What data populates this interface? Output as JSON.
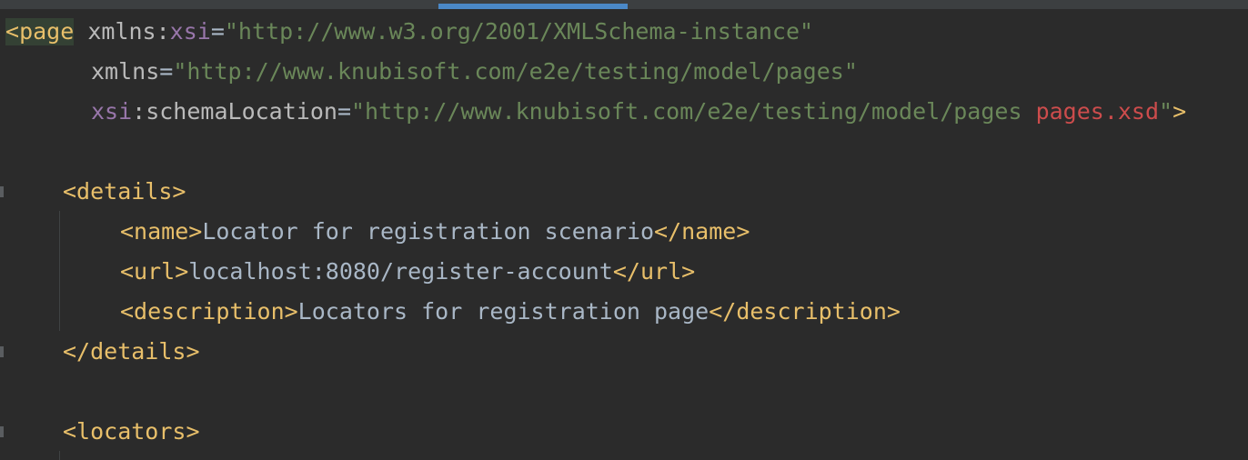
{
  "editor": {
    "line1": {
      "open": "<",
      "tag": "page",
      "attr1_name_plain": "xmlns:",
      "attr1_name_ns": "xsi",
      "attr1_eq": "=",
      "attr1_value": "\"http://www.w3.org/2001/XMLSchema-instance\""
    },
    "line2": {
      "attr_name": "xmlns",
      "eq": "=",
      "value": "\"http://www.knubisoft.com/e2e/testing/model/pages\""
    },
    "line3": {
      "attr_ns": "xsi",
      "attr_name": ":schemaLocation",
      "eq": "=",
      "value_start": "\"http://www.knubisoft.com/e2e/testing/model/pages ",
      "value_file": "pages.xsd",
      "value_end": "\"",
      "close": ">"
    },
    "details_open": "<details>",
    "name_line": {
      "open": "<name>",
      "text": "Locator for registration scenario",
      "close": "</name>"
    },
    "url_line": {
      "open": "<url>",
      "text": "localhost:8080/register-account",
      "close": "</url>"
    },
    "description_line": {
      "open": "<description>",
      "text": "Locators for registration page",
      "close": "</description>"
    },
    "details_close": "</details>",
    "locators_open": "<locators>"
  },
  "colors": {
    "background": "#2b2b2b",
    "tag": "#e8bf6a",
    "attribute": "#bababa",
    "namespace": "#9876aa",
    "string": "#6a8759",
    "error_string": "#cc4c4c",
    "text": "#a9b7c6",
    "scroll_indicator": "#4a88c7"
  }
}
